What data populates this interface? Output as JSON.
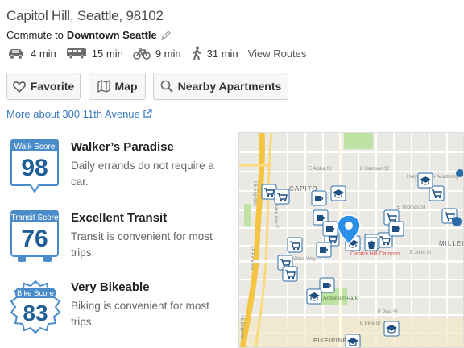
{
  "header": {
    "address": "Capitol Hill, Seattle, 98102",
    "commute_prefix": "Commute to",
    "commute_destination": "Downtown Seattle"
  },
  "commute_modes": [
    {
      "icon": "car-icon",
      "time": "4 min"
    },
    {
      "icon": "bus-icon",
      "time": "15 min"
    },
    {
      "icon": "bike-icon",
      "time": "9 min"
    },
    {
      "icon": "walk-icon",
      "time": "31 min"
    }
  ],
  "view_routes": "View Routes",
  "buttons": {
    "favorite": "Favorite",
    "map": "Map",
    "nearby": "Nearby Apartments"
  },
  "more_link": "More about 300 11th Avenue",
  "scores": {
    "walk": {
      "badge_label": "Walk Score",
      "value": "98",
      "title": "Walker’s Paradise",
      "desc": "Daily errands do not require a car."
    },
    "transit": {
      "badge_label": "Transit Score",
      "value": "76",
      "title": "Excellent Transit",
      "desc": "Transit is convenient for most trips."
    },
    "bike": {
      "badge_label": "Bike Score",
      "value": "83",
      "title": "Very Bikeable",
      "desc": "Biking is convenient for most trips."
    }
  },
  "map": {
    "labels": {
      "capitol": "CAPITO",
      "millei": "MILLEI",
      "campus": "Capitol Hill Campus",
      "park": "Anderson Park",
      "pike": "PIKE/PINE",
      "aloha": "E Aloha St",
      "harrison": "E Harrison St",
      "thomas": "E Thomas St",
      "john": "E John St",
      "olive": "E Olive Way",
      "pike_st": "E Pike St",
      "pine": "E Pine St",
      "academy": "Holy Names Academy",
      "express1": "I-5 Express",
      "express2": "I-5 Express",
      "express3": "I-5 Express",
      "eastlake": "Eastlake Ave E"
    },
    "colors": {
      "marker": "#2b8fe8",
      "freeway": "#f4c542",
      "park": "#bfe3a4"
    }
  }
}
